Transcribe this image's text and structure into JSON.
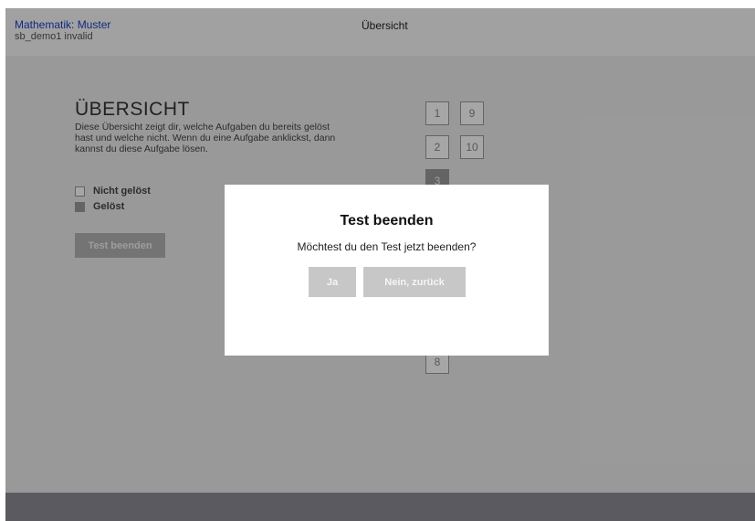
{
  "header": {
    "title": "Mathematik: Muster",
    "subtitle": "sb_demo1 invalid",
    "center_title": "Übersicht"
  },
  "overview": {
    "heading": "ÜBERSICHT",
    "description": "Diese Übersicht zeigt dir, welche Aufgaben du bereits gelöst hast und welche nicht. Wenn du eine Aufgabe anklickst, dann kannst du diese Aufgabe lösen.",
    "legend": {
      "unsolved": "Nicht gelöst",
      "solved": "Gelöst"
    },
    "end_button": "Test beenden"
  },
  "tasks": [
    {
      "label": "1",
      "solved": false
    },
    {
      "label": "9",
      "solved": false
    },
    {
      "label": "2",
      "solved": false
    },
    {
      "label": "10",
      "solved": false
    },
    {
      "label": "3",
      "solved": true
    },
    {
      "label": "8",
      "solved": false
    }
  ],
  "modal": {
    "title": "Test beenden",
    "message": "Möchtest du den Test jetzt beenden?",
    "yes_label": "Ja",
    "no_label": "Nein, zurück"
  }
}
